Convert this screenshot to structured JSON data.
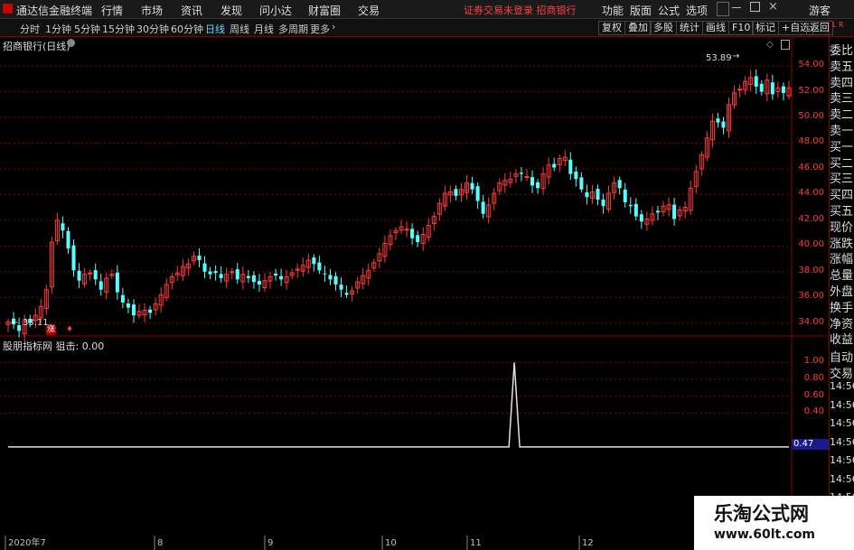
{
  "app": {
    "title": "通达信金融终端",
    "menus": [
      "行情",
      "市场",
      "资讯",
      "发现",
      "问小达",
      "财富圈",
      "交易"
    ],
    "notice": "证券交易未登录  招商银行",
    "right_menus": [
      "功能",
      "版面",
      "公式",
      "选项"
    ],
    "guest": "游客"
  },
  "toolbar": {
    "periods": [
      "分时",
      "1分钟",
      "5分钟",
      "15分钟",
      "30分钟",
      "60分钟",
      "日线",
      "周线",
      "月线",
      "多周期",
      "更多"
    ],
    "active_period": "日线",
    "buttons": [
      "复权",
      "叠加",
      "多股",
      "统计",
      "画线",
      "F10",
      "标记",
      "+自选",
      "返回"
    ]
  },
  "main_chart": {
    "label": "招商银行(日线)",
    "high_marker": "53.89",
    "low_marker": "33.11",
    "badge": "涨"
  },
  "indicator": {
    "label": "股朋指标网 狙击: 0.00",
    "current_value_tag": "0.47"
  },
  "side_panel": {
    "corner": "L R",
    "items": [
      "委比",
      "卖五",
      "卖四",
      "卖三",
      "卖二",
      "卖一",
      "买一",
      "买二",
      "买三",
      "买四",
      "买五",
      "现价",
      "涨跌",
      "涨幅",
      "总量",
      "外盘",
      "换手",
      "净资",
      "收益"
    ],
    "lower_items": [
      "自动",
      "交易"
    ],
    "times": [
      "14:56",
      "14:56",
      "14:56",
      "14:56",
      "14:56",
      "14:56",
      "14:56",
      "14:56",
      "14:56"
    ]
  },
  "watermark": {
    "line1": "乐淘公式网",
    "line2": "www.60lt.com"
  },
  "colors": {
    "up": "#ff3b3b",
    "down": "#54ffff",
    "grid": "#8b0000",
    "indicator_line": "#e0e0e0"
  },
  "chart_data": [
    {
      "type": "candlestick",
      "title": "招商银行(日线)",
      "y_ticks": [
        34.0,
        36.0,
        38.0,
        40.0,
        42.0,
        44.0,
        46.0,
        48.0,
        50.0,
        52.0,
        54.0
      ],
      "ylim": [
        33.0,
        55.2
      ],
      "x_ticks": [
        "2020年7",
        "8",
        "9",
        "10",
        "11",
        "12"
      ],
      "annotations": [
        "53.89",
        "33.11"
      ],
      "series": [
        {
          "name": "close",
          "values": [
            34.1,
            33.9,
            33.4,
            34.2,
            34.0,
            34.6,
            35.3,
            36.6,
            40.3,
            42.0,
            41.2,
            39.8,
            38.1,
            37.3,
            37.8,
            37.9,
            37.4,
            36.6,
            37.5,
            37.8,
            36.4,
            35.6,
            35.2,
            34.6,
            34.9,
            35.0,
            34.8,
            35.5,
            36.2,
            37.0,
            37.6,
            37.9,
            38.4,
            38.6,
            39.2,
            38.9,
            38.0,
            37.8,
            37.9,
            37.5,
            37.8,
            38.0,
            37.4,
            37.8,
            37.5,
            37.2,
            37.0,
            37.3,
            37.6,
            37.7,
            37.4,
            37.6,
            37.9,
            38.2,
            38.5,
            38.9,
            38.6,
            38.1,
            37.8,
            37.4,
            37.0,
            36.6,
            36.2,
            36.5,
            37.2,
            37.7,
            38.1,
            38.7,
            39.4,
            40.2,
            40.8,
            41.2,
            41.5,
            41.3,
            40.6,
            40.3,
            40.9,
            41.6,
            42.3,
            43.3,
            44.1,
            44.2,
            43.9,
            44.4,
            44.9,
            44.4,
            43.5,
            42.5,
            43.2,
            44.1,
            44.9,
            45.1,
            45.2,
            45.6,
            45.6,
            45.4,
            44.7,
            44.5,
            45.6,
            46.3,
            46.1,
            46.8,
            46.9,
            45.6,
            45.2,
            44.4,
            43.8,
            44.2,
            43.6,
            43.1,
            44.1,
            44.9,
            44.5,
            43.4,
            43.1,
            42.3,
            41.9,
            42.1,
            42.5,
            42.6,
            43.1,
            43.2,
            42.1,
            42.8,
            43.0,
            44.5,
            45.8,
            47.1,
            48.4,
            49.7,
            49.6,
            49.2,
            51.0,
            51.9,
            52.2,
            52.8,
            53.1,
            52.4,
            52.0,
            52.9,
            51.8,
            52.3,
            51.9,
            52.3
          ]
        }
      ]
    },
    {
      "type": "line",
      "title": "股朋指标网 狙击",
      "y_ticks": [
        0.4,
        0.6,
        0.8,
        1.0
      ],
      "ylim": [
        -1.05,
        1.1
      ],
      "series": [
        {
          "name": "狙击",
          "values": [
            0,
            0,
            0,
            0,
            0,
            0,
            0,
            0,
            0,
            0,
            0,
            0,
            0,
            0,
            0,
            0,
            0,
            0,
            0,
            0,
            0,
            0,
            0,
            0,
            0,
            0,
            0,
            0,
            0,
            0,
            0,
            0,
            0,
            0,
            0,
            0,
            0,
            0,
            0,
            0,
            0,
            0,
            0,
            0,
            0,
            0,
            0,
            0,
            0,
            0,
            0,
            0,
            0,
            0,
            0,
            0,
            0,
            0,
            0,
            0,
            0,
            0,
            0,
            0,
            0,
            0,
            0,
            0,
            0,
            0,
            0,
            0,
            0,
            0,
            0,
            0,
            0,
            0,
            0,
            0,
            0,
            0,
            0,
            0,
            0,
            0,
            0,
            0,
            0,
            0,
            0,
            0,
            0,
            0,
            1,
            0,
            0,
            0,
            0,
            0,
            0,
            0,
            0,
            0,
            0,
            0,
            0,
            0,
            0,
            0,
            0,
            0,
            0,
            0,
            0,
            0,
            0,
            0,
            0,
            0,
            0,
            0,
            0,
            0,
            0,
            0,
            0,
            0,
            0,
            0,
            0,
            0,
            0,
            0,
            0,
            0,
            0,
            0,
            0,
            0,
            0,
            0,
            0,
            0,
            0,
            0
          ]
        }
      ]
    }
  ]
}
